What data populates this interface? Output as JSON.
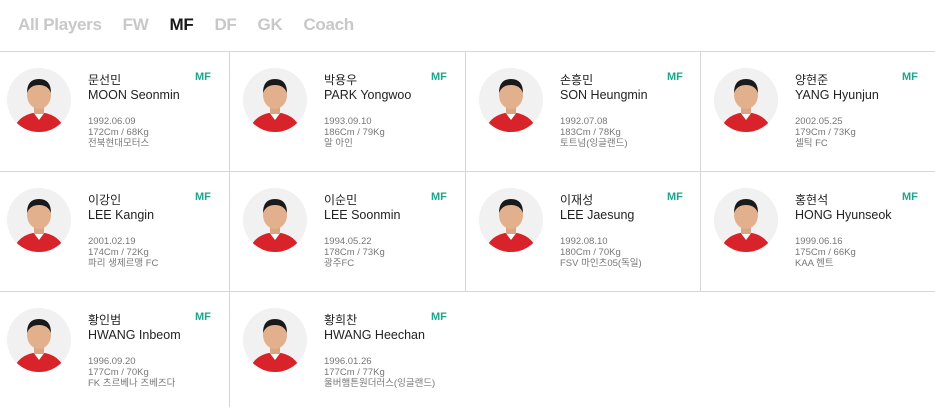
{
  "tabs": [
    {
      "label": "All Players",
      "active": false
    },
    {
      "label": "FW",
      "active": false
    },
    {
      "label": "MF",
      "active": true
    },
    {
      "label": "DF",
      "active": false
    },
    {
      "label": "GK",
      "active": false
    },
    {
      "label": "Coach",
      "active": false
    }
  ],
  "players": [
    {
      "name_ko": "문선민",
      "name_en": "MOON Seonmin",
      "position": "MF",
      "birth": "1992.06.09",
      "body": "172Cm / 68Kg",
      "club": "전북현대모터스"
    },
    {
      "name_ko": "박용우",
      "name_en": "PARK Yongwoo",
      "position": "MF",
      "birth": "1993.09.10",
      "body": "186Cm / 79Kg",
      "club": "알 아인"
    },
    {
      "name_ko": "손흥민",
      "name_en": "SON Heungmin",
      "position": "MF",
      "birth": "1992.07.08",
      "body": "183Cm / 78Kg",
      "club": "토트넘(잉글랜드)"
    },
    {
      "name_ko": "양현준",
      "name_en": "YANG Hyunjun",
      "position": "MF",
      "birth": "2002.05.25",
      "body": "179Cm / 73Kg",
      "club": "셀틱 FC"
    },
    {
      "name_ko": "이강인",
      "name_en": "LEE Kangin",
      "position": "MF",
      "birth": "2001.02.19",
      "body": "174Cm / 72Kg",
      "club": "파리 생제르맹 FC"
    },
    {
      "name_ko": "이순민",
      "name_en": "LEE Soonmin",
      "position": "MF",
      "birth": "1994.05.22",
      "body": "178Cm / 73Kg",
      "club": "광주FC"
    },
    {
      "name_ko": "이재성",
      "name_en": "LEE Jaesung",
      "position": "MF",
      "birth": "1992.08.10",
      "body": "180Cm / 70Kg",
      "club": "FSV 마인츠05(독일)"
    },
    {
      "name_ko": "홍현석",
      "name_en": "HONG Hyunseok",
      "position": "MF",
      "birth": "1999.06.16",
      "body": "175Cm / 66Kg",
      "club": "KAA 헨트"
    },
    {
      "name_ko": "황인범",
      "name_en": "HWANG Inbeom",
      "position": "MF",
      "birth": "1996.09.20",
      "body": "177Cm / 70Kg",
      "club": "FK 츠르베나 즈베즈다"
    },
    {
      "name_ko": "황희찬",
      "name_en": "HWANG Heechan",
      "position": "MF",
      "birth": "1996.01.26",
      "body": "177Cm / 77Kg",
      "club": "울버햄튼원더러스(잉글랜드)"
    }
  ],
  "colors": {
    "accent": "#1fa68a",
    "jersey": "#d8232a",
    "tab_inactive": "#c8c8c8",
    "tab_active": "#1a1a1a"
  }
}
